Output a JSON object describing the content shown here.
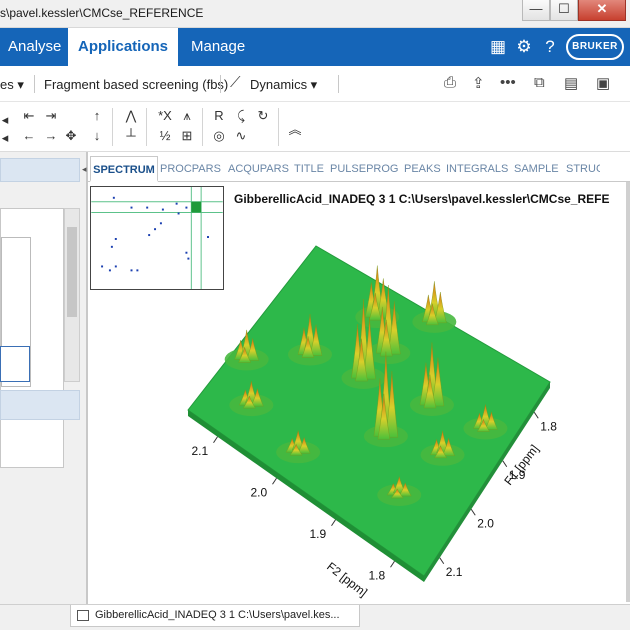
{
  "window": {
    "title": "s\\pavel.kessler\\CMCse_REFERENCE",
    "minimize": "—",
    "maximize": "☐",
    "close": "✕"
  },
  "ribbon": {
    "tabs": [
      {
        "label": "Analyse",
        "accel": "A",
        "rest": "nalyse"
      },
      {
        "label": "Applications",
        "accel": "",
        "rest": "Applications"
      },
      {
        "label": "Manage",
        "accel": "M",
        "rest": "anage"
      }
    ],
    "active_tab": "Applications",
    "icons": [
      "layout-icon",
      "gear-icon",
      "help-icon"
    ],
    "logo_text": "BRUKER"
  },
  "subtoolbar": {
    "items": [
      {
        "label": "es ▾"
      },
      {
        "label": "Fragment based screening (fbs)"
      },
      {
        "label": "Dynamics ▾"
      }
    ]
  },
  "display_tabs": [
    "SPECTRUM",
    "PROCPARS",
    "ACQUPARS",
    "TITLE",
    "PULSEPROG",
    "PEAKS",
    "INTEGRALS",
    "SAMPLE",
    "STRUC"
  ],
  "active_display_tab": "SPECTRUM",
  "spectrum_title": "GibberellicAcid_INADEQ  3  1  C:\\Users\\pavel.kessler\\CMCse_REFE",
  "chart_data": {
    "type": "surface3d",
    "title": "GibberellicAcid_INADEQ  3  1  C:\\Users\\pavel.kessler\\CMCse_REFE",
    "x_axis": {
      "label": "F2 [ppm]",
      "ticks": [
        "2.1",
        "2.0",
        "1.9",
        "1.8"
      ],
      "range": [
        2.15,
        1.75
      ]
    },
    "y_axis": {
      "label": "F1 [ppm]",
      "ticks": [
        "2.1",
        "2.0",
        "1.9",
        "1.8"
      ],
      "range": [
        2.15,
        1.75
      ]
    },
    "surface_color": "#2db84a",
    "peak_color": "#e07a1c",
    "peaks": [
      {
        "f2": 2.12,
        "f1": 2.02,
        "height": 0.25
      },
      {
        "f2": 2.05,
        "f1": 1.95,
        "height": 0.35
      },
      {
        "f2": 2.0,
        "f1": 1.83,
        "height": 0.45
      },
      {
        "f2": 1.97,
        "f1": 1.93,
        "height": 0.7
      },
      {
        "f2": 1.96,
        "f1": 1.87,
        "height": 0.6
      },
      {
        "f2": 1.93,
        "f1": 1.78,
        "height": 0.35
      },
      {
        "f2": 1.9,
        "f1": 1.99,
        "height": 0.75
      },
      {
        "f2": 1.87,
        "f1": 1.9,
        "height": 0.55
      },
      {
        "f2": 1.82,
        "f1": 1.96,
        "height": 0.2
      },
      {
        "f2": 1.79,
        "f1": 1.88,
        "height": 0.2
      },
      {
        "f2": 1.84,
        "f1": 2.06,
        "height": 0.15
      },
      {
        "f2": 2.08,
        "f1": 2.08,
        "height": 0.2
      },
      {
        "f2": 1.99,
        "f1": 2.1,
        "height": 0.18
      }
    ]
  },
  "statusbar": {
    "tab_label": "GibberellicAcid_INADEQ  3  1  C:\\Users\\pavel.kes..."
  }
}
